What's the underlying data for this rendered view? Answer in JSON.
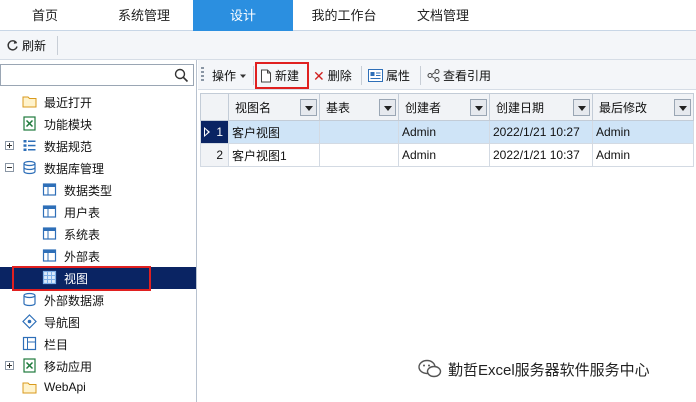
{
  "top_menu": {
    "tabs": [
      {
        "label": "首页"
      },
      {
        "label": "系统管理"
      },
      {
        "label": "设计"
      },
      {
        "label": "我的工作台"
      },
      {
        "label": "文档管理"
      }
    ],
    "active_tab": "设计"
  },
  "subbar": {
    "refresh_label": "刷新"
  },
  "sidebar": {
    "search": {
      "value": "",
      "placeholder": ""
    },
    "items": [
      {
        "label": "最近打开",
        "icon": "folder-icon"
      },
      {
        "label": "功能模块",
        "icon": "excel-icon"
      },
      {
        "label": "数据规范",
        "icon": "list-icon",
        "expander": "plus"
      },
      {
        "label": "数据库管理",
        "icon": "database-icon",
        "expander": "minus"
      },
      {
        "label": "数据类型",
        "icon": "table-icon"
      },
      {
        "label": "用户表",
        "icon": "table-icon"
      },
      {
        "label": "系统表",
        "icon": "table-icon"
      },
      {
        "label": "外部表",
        "icon": "table-icon"
      },
      {
        "label": "视图",
        "icon": "grid-icon",
        "selected": true
      },
      {
        "label": "外部数据源",
        "icon": "external-db-icon"
      },
      {
        "label": "导航图",
        "icon": "navigation-icon"
      },
      {
        "label": "栏目",
        "icon": "column-icon"
      },
      {
        "label": "移动应用",
        "icon": "excel-icon",
        "expander": "plus"
      },
      {
        "label": "WebApi",
        "icon": "folder-icon"
      }
    ]
  },
  "toolbar": {
    "operate_label": "操作",
    "new_label": "新建",
    "delete_label": "删除",
    "properties_label": "属性",
    "view_refs_label": "查看引用"
  },
  "grid": {
    "columns": [
      "视图名",
      "基表",
      "创建者",
      "创建日期",
      "最后修改"
    ],
    "rows": [
      {
        "num": "1",
        "cells": [
          "客户视图",
          "",
          "Admin",
          "2022/1/21 10:27",
          "Admin"
        ],
        "selected": true
      },
      {
        "num": "2",
        "cells": [
          "客户视图1",
          "",
          "Admin",
          "2022/1/21 10:37",
          "Admin"
        ],
        "selected": false
      }
    ]
  },
  "watermark": {
    "text": "勤哲Excel服务器软件服务中心"
  },
  "colors": {
    "active_tab": "#2b8fe0",
    "selected_row": "#0a2463",
    "highlight_row": "#cfe4f7",
    "annotation_box": "#e02020"
  }
}
